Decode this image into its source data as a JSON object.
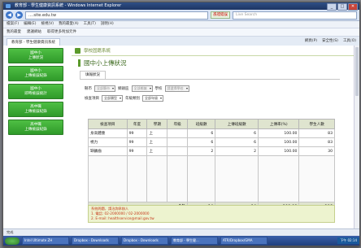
{
  "window": {
    "title": "教育部 - 學生健康資訊系統 - Windows Internet Explorer"
  },
  "address": {
    "url": "....site.edu.tw",
    "ssl_label": "憑證錯誤",
    "search_placeholder": "Live Search"
  },
  "menu": [
    "檔案(F)",
    "編輯(E)",
    "檢視(V)",
    "我的最愛(A)",
    "工具(T)",
    "說明(H)"
  ],
  "favorites": [
    "我的最愛",
    "建議網站",
    "取得更多附加元件"
  ],
  "browser_tab": {
    "label": "教育部 - 學生健康資訊系統",
    "tools": [
      "網頁(P)",
      "安全性(S)",
      "工具(O)"
    ]
  },
  "sidebar": [
    {
      "line1": "國中小",
      "line2": "上傳狀況"
    },
    {
      "line1": "國中小",
      "line2": "上傳檢誤紀錄"
    },
    {
      "line1": "國中小",
      "line2": "即時檢誤統計"
    },
    {
      "line1": "高中職",
      "line2": "上傳檢誤紀錄"
    },
    {
      "line1": "高中職",
      "line2": "上傳檢誤紀錄"
    }
  ],
  "system_header": "學校固籍系統",
  "page_title": "國中小上傳狀況",
  "sub_tab": "填報狀況",
  "filters": {
    "row1": [
      {
        "label": "縣市",
        "value": "全部縣市",
        "disabled": true
      },
      {
        "label": "鄉鎮區",
        "value": "全部鄉鎮",
        "disabled": true
      },
      {
        "label": "學校",
        "value": "請選擇學校",
        "disabled": true
      }
    ],
    "row2": [
      {
        "label": "檢查項目",
        "value": "全部類型",
        "disabled": false
      },
      {
        "label": "年級類別",
        "value": "全部年級",
        "disabled": false
      }
    ]
  },
  "table": {
    "headers": [
      "檢查項目",
      "年度",
      "學期",
      "年級",
      "班級數",
      "上傳班級數",
      "上傳率(%)",
      "學生人數"
    ],
    "rows": [
      [
        "身高體重",
        "99",
        "上",
        "",
        "6",
        "6",
        "100.00",
        "83"
      ],
      [
        "視力",
        "99",
        "上",
        "",
        "6",
        "6",
        "100.00",
        "83"
      ],
      [
        "缺齲齒",
        "99",
        "上",
        "",
        "2",
        "2",
        "100.00",
        "30"
      ]
    ],
    "total": {
      "label": "合計",
      "classes": "14",
      "uploaded": "14",
      "rate": "100.00",
      "students": "196"
    }
  },
  "contact": {
    "title": "系統問題，請洽詢承辦人",
    "line1": "1. 電話: 02-2000000 / 02-2000000",
    "line2": "2. E-mail: healthservice@mail.gov.tw"
  },
  "status": {
    "text": "完成"
  },
  "taskbar": {
    "start": "開始",
    "tasks": [
      "Intel Ultimate ZH",
      "Dropbox - Downloads",
      "Dropbox - Downloads",
      "教育部 - 學生健...",
      "ATR/Dropbox/GMA"
    ],
    "tray": "下午 02:14"
  },
  "colors": {
    "accent": "#3b9a2f",
    "title_bar": "#24407a",
    "header_green": "#5b9a2b"
  }
}
